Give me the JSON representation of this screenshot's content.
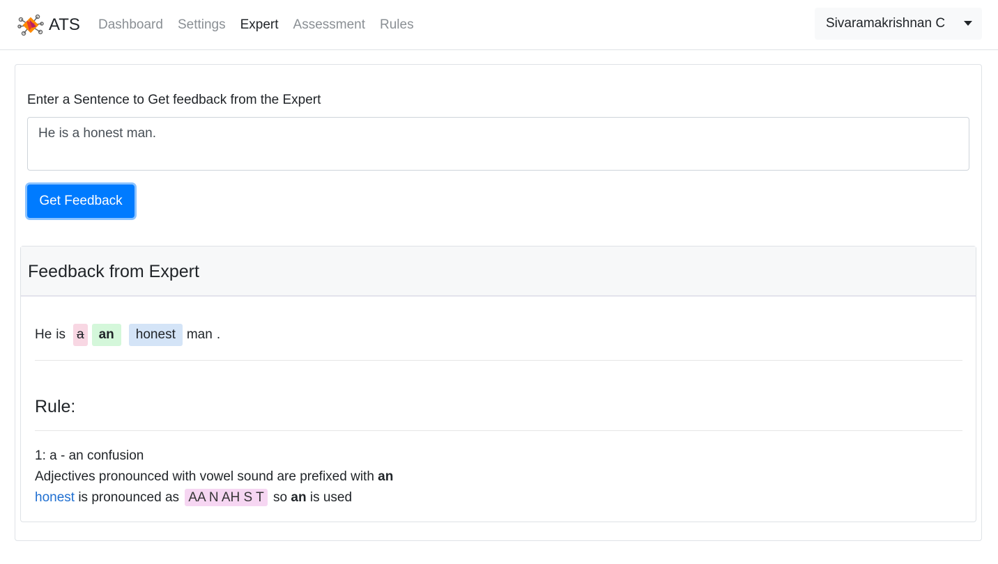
{
  "navbar": {
    "brand": "ATS",
    "links": [
      {
        "label": "Dashboard",
        "active": false
      },
      {
        "label": "Settings",
        "active": false
      },
      {
        "label": "Expert",
        "active": true
      },
      {
        "label": "Assessment",
        "active": false
      },
      {
        "label": "Rules",
        "active": false
      }
    ],
    "user": "Sivaramakrishnan C",
    "user_dropdown_icon": "caret-down-icon",
    "logo_icon": "ats-logo-icon"
  },
  "form": {
    "label": "Enter a Sentence to Get feedback from the Expert",
    "input_value": "He is a honest man.",
    "button_label": "Get Feedback"
  },
  "feedback": {
    "title": "Feedback from Expert",
    "tokens": {
      "w1": "He",
      "w2": "is",
      "deleted": "a",
      "inserted": "an",
      "highlighted": "honest",
      "w6": "man",
      "punct": "."
    },
    "rule": {
      "heading": "Rule:",
      "title": "1: a - an confusion",
      "description_prefix": "Adjectives pronounced with vowel sound are prefixed with",
      "description_bold": "an",
      "word": "honest",
      "pronounced_as": "is pronounced as",
      "phonetic": "AA N AH S T",
      "so": "so",
      "used_word": "an",
      "is_used": "is used"
    }
  },
  "colors": {
    "primary": "#007bff",
    "deleted_bg": "#f8d7e3",
    "inserted_bg": "#d4f7da",
    "highlight_bg": "#d4e4f7",
    "phonetic_bg": "#f6d6f2",
    "link": "#1f6fd1"
  }
}
